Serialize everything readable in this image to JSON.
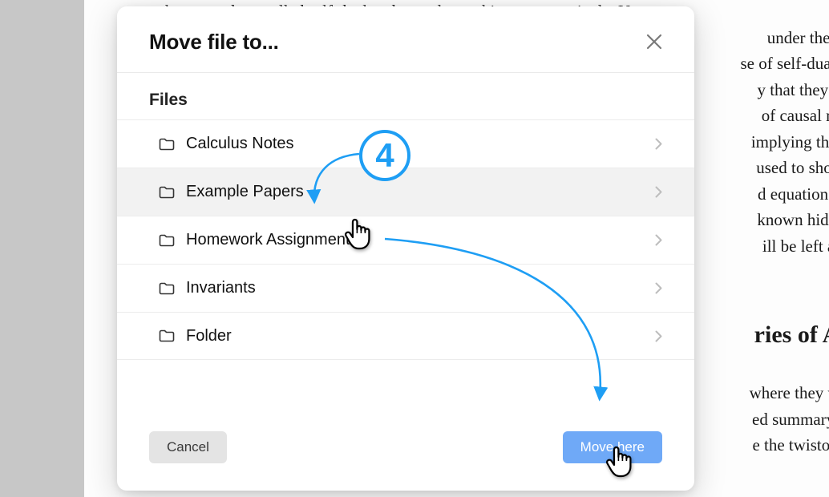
{
  "modal": {
    "title": "Move file to...",
    "filesLabel": "Files",
    "folders": [
      {
        "label": "Calculus Notes"
      },
      {
        "label": "Example Papers"
      },
      {
        "label": "Homework Assignments"
      },
      {
        "label": "Invariants"
      },
      {
        "label": "Folder"
      }
    ],
    "cancelLabel": "Cancel",
    "moveLabel": "Move here"
  },
  "tutorial": {
    "stepNumber": "4"
  },
  "background": {
    "lines": [
      "theory, and are called self-dual and causal morphisms, respectively.  U",
      "under these t",
      "se of self-dual m",
      "y that they are",
      "of causal mor",
      "implying that a",
      "used to show t",
      "d equations as",
      "known hidden ",
      "ill be left as a"
    ],
    "heading": "ries of AS",
    "para2": [
      "where they wer",
      "ed summary of",
      "e the twistor o"
    ]
  }
}
